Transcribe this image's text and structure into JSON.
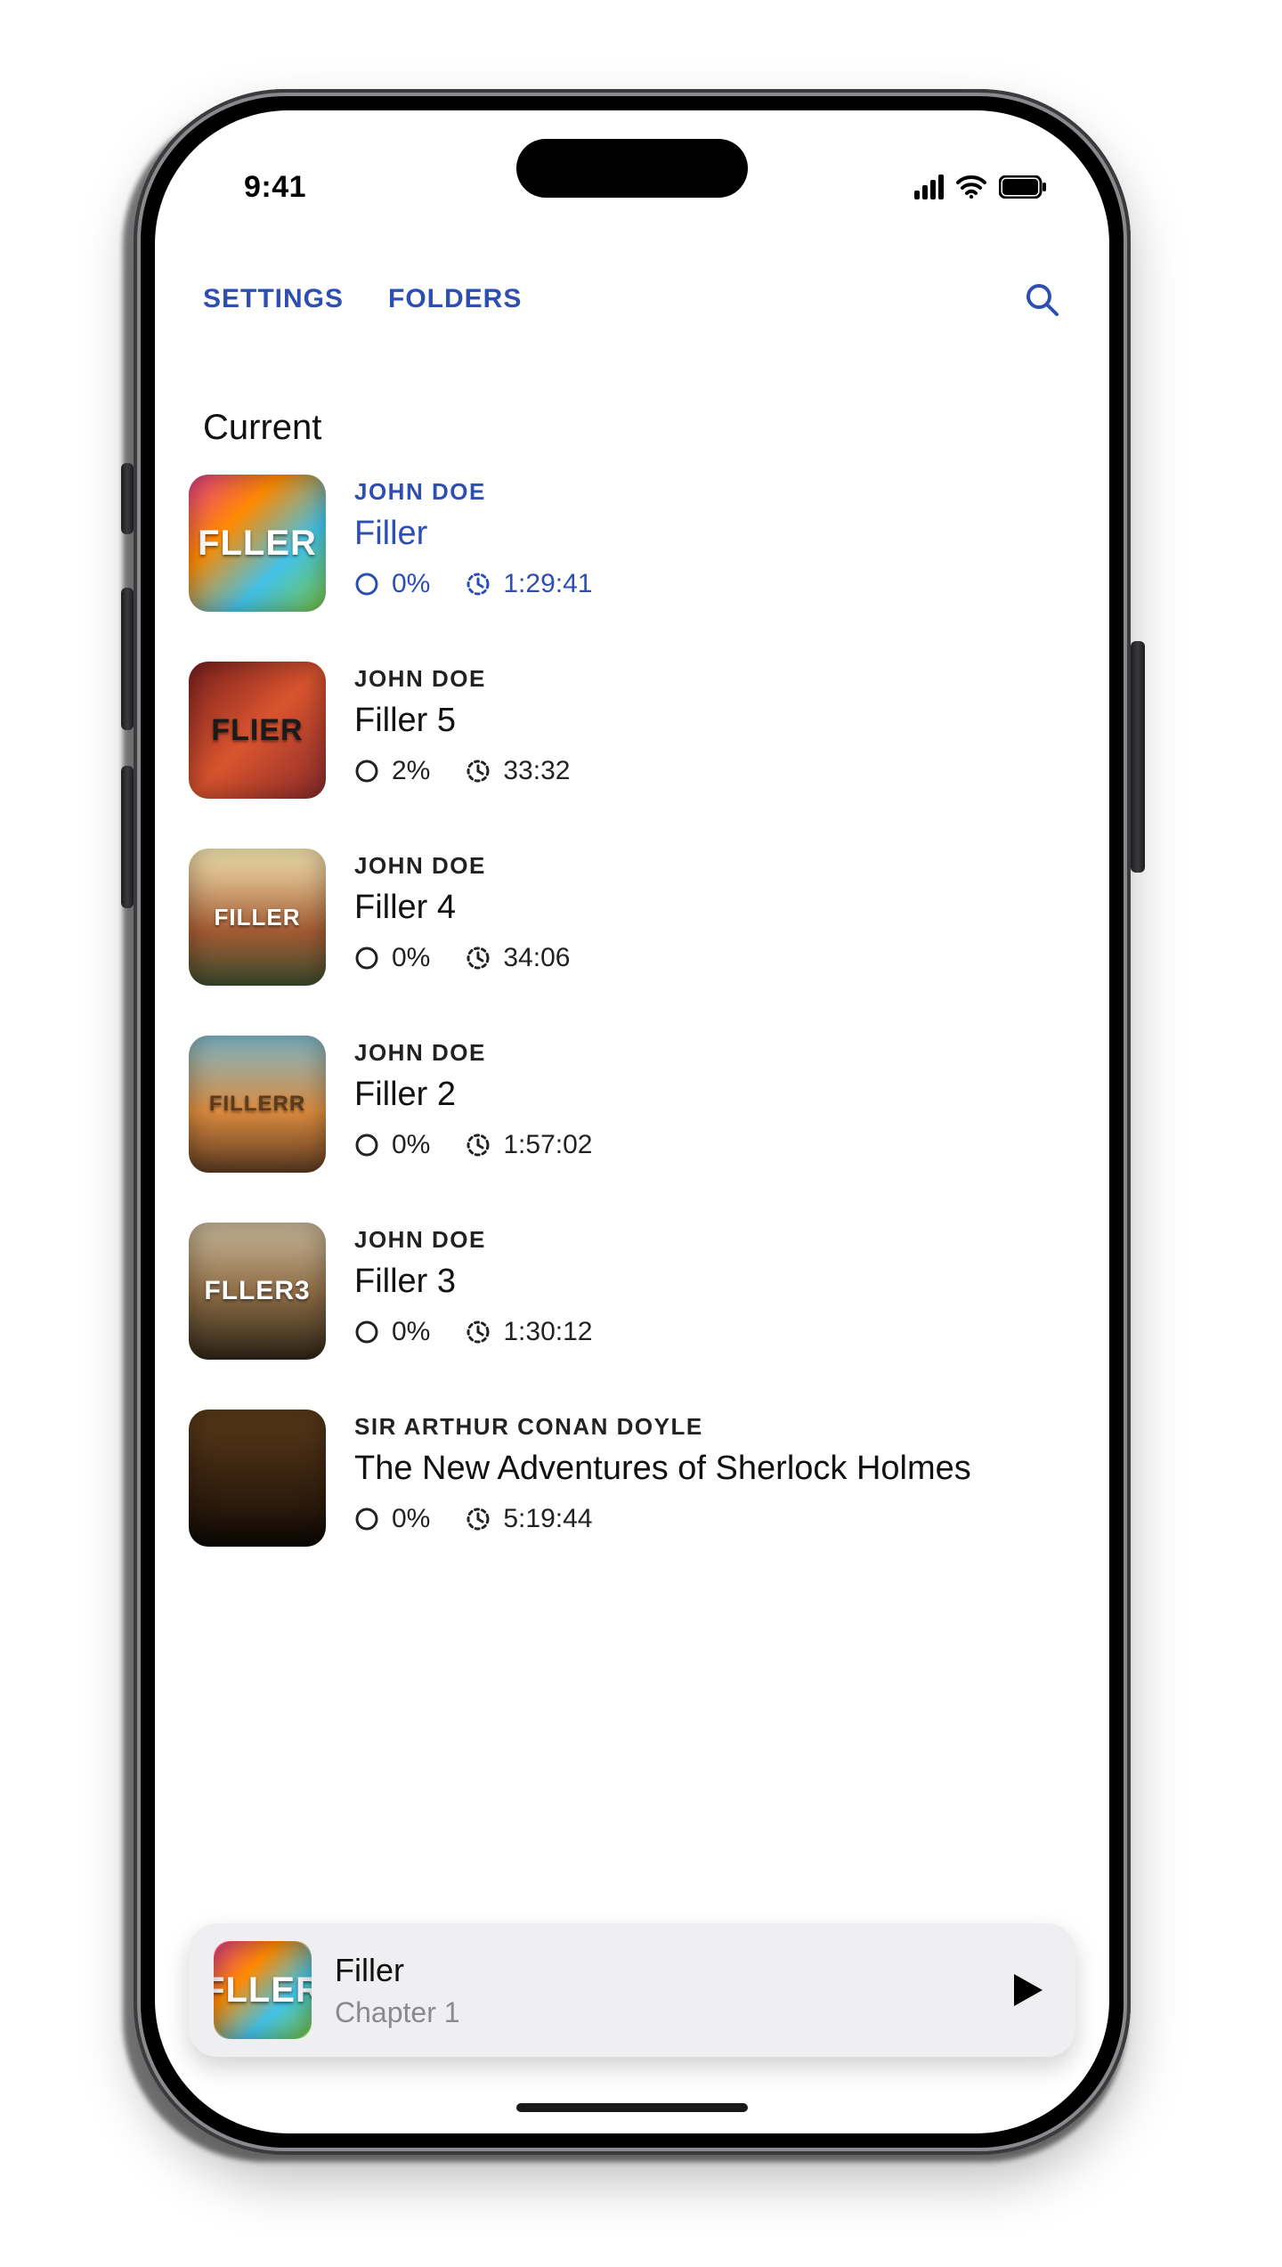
{
  "status": {
    "time": "9:41"
  },
  "topbar": {
    "settings_label": "SETTINGS",
    "folders_label": "FOLDERS"
  },
  "section_title": "Current",
  "books": [
    {
      "author": "JOHN DOE",
      "title": "Filler",
      "progress": "0%",
      "duration": "1:29:41",
      "cover_label": "FLLER",
      "cover_class": "cov0",
      "active": true
    },
    {
      "author": "JOHN DOE",
      "title": "Filler 5",
      "progress": "2%",
      "duration": "33:32",
      "cover_label": "FLIER",
      "cover_class": "cov1",
      "active": false
    },
    {
      "author": "JOHN DOE",
      "title": "Filler 4",
      "progress": "0%",
      "duration": "34:06",
      "cover_label": "FILLER",
      "cover_class": "cov2",
      "active": false
    },
    {
      "author": "JOHN DOE",
      "title": "Filler 2",
      "progress": "0%",
      "duration": "1:57:02",
      "cover_label": "FILLERR",
      "cover_class": "cov3",
      "active": false
    },
    {
      "author": "JOHN DOE",
      "title": "Filler 3",
      "progress": "0%",
      "duration": "1:30:12",
      "cover_label": "FLLER3",
      "cover_class": "cov4",
      "active": false
    },
    {
      "author": "SIR ARTHUR CONAN DOYLE",
      "title": "The New Adventures of Sherlock Holmes",
      "progress": "0%",
      "duration": "5:19:44",
      "cover_label": "",
      "cover_class": "cov5",
      "active": false
    }
  ],
  "nowplaying": {
    "title": "Filler",
    "subtitle": "Chapter 1",
    "cover_label": "FLLER",
    "cover_class": "cov0"
  }
}
